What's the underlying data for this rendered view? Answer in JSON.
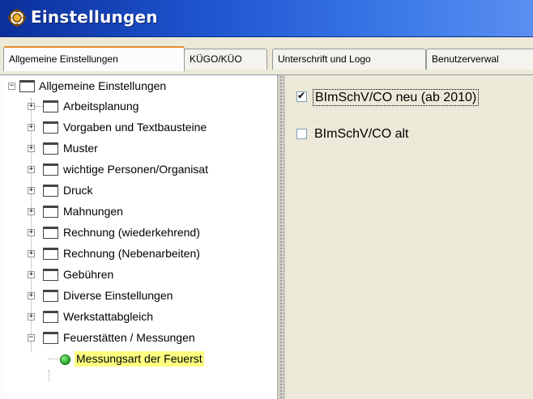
{
  "window": {
    "title": "Einstellungen",
    "app_icon": "gear-face-icon",
    "title_bar_color": "#1f56d1"
  },
  "tabs": [
    {
      "label": "Allgemeine Einstellungen",
      "active": true
    },
    {
      "label": "KÜGO/KÜO",
      "active": false
    },
    {
      "label": "Unterschrift und Logo",
      "active": false
    },
    {
      "label": "Benutzerverwal",
      "active": false
    }
  ],
  "tree": {
    "root": {
      "label": "Allgemeine Einstellungen",
      "expanded": true
    },
    "items": [
      {
        "label": "Arbeitsplanung",
        "expanded": false
      },
      {
        "label": "Vorgaben und Textbausteine",
        "expanded": false
      },
      {
        "label": "Muster",
        "expanded": false
      },
      {
        "label": "wichtige Personen/Organisat",
        "expanded": false
      },
      {
        "label": "Druck",
        "expanded": false
      },
      {
        "label": "Mahnungen",
        "expanded": false
      },
      {
        "label": "Rechnung (wiederkehrend)",
        "expanded": false
      },
      {
        "label": "Rechnung (Nebenarbeiten)",
        "expanded": false
      },
      {
        "label": "Gebühren",
        "expanded": false
      },
      {
        "label": "Diverse Einstellungen",
        "expanded": false
      },
      {
        "label": "Werkstattabgleich",
        "expanded": false
      },
      {
        "label": "Feuerstätten / Messungen",
        "expanded": true
      }
    ],
    "leaf": {
      "label": "Messungsart der Feuerst",
      "selected": true,
      "highlight": "#ffff80"
    }
  },
  "settings": {
    "options": [
      {
        "label": "BImSchV/CO neu (ab 2010)",
        "checked": true,
        "focused": true
      },
      {
        "label": "BImSchV/CO alt",
        "checked": false,
        "focused": false
      }
    ]
  }
}
